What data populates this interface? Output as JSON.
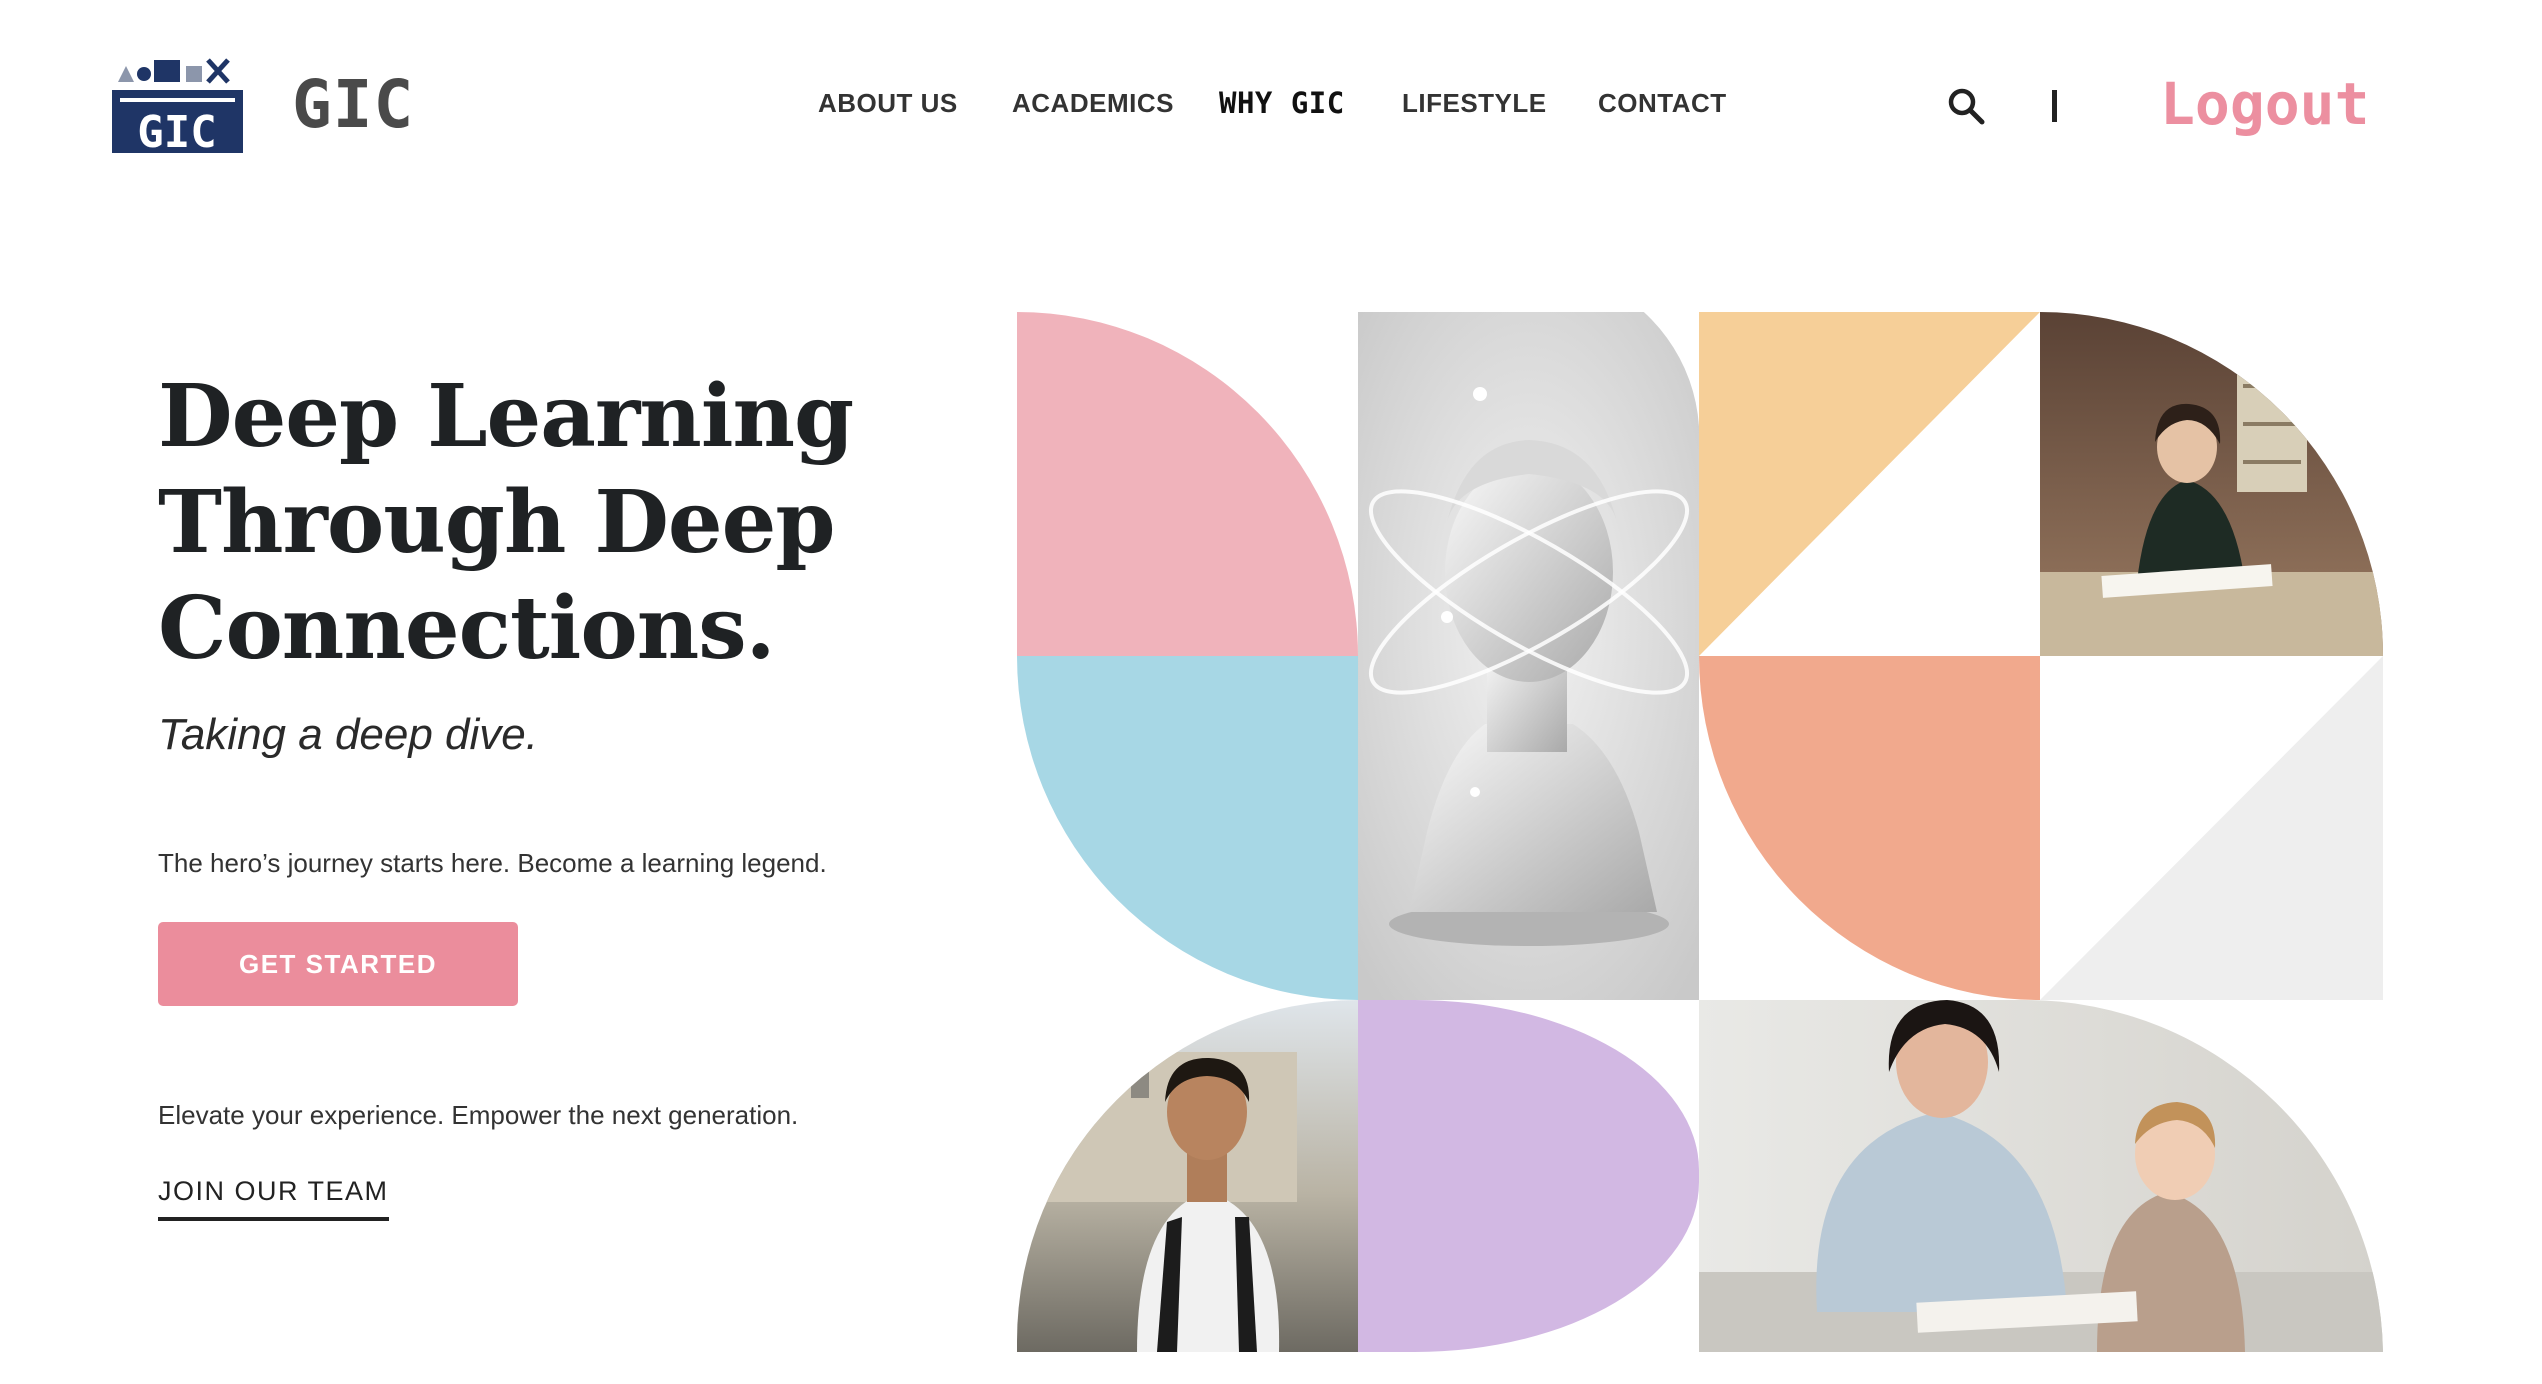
{
  "header": {
    "brand": "GIC",
    "logo_text": "GIC",
    "nav": [
      {
        "label": "ABOUT US"
      },
      {
        "label": "ACADEMICS"
      },
      {
        "label": "WHY GIC"
      },
      {
        "label": "LIFESTYLE"
      },
      {
        "label": "CONTACT"
      }
    ],
    "search_icon": "search-icon",
    "logout_label": "Logout"
  },
  "hero": {
    "title_lines": [
      "Deep Learning",
      "Through Deep",
      "Connections."
    ],
    "subtitle": "Taking a deep dive.",
    "description": "The hero’s journey starts here. Become a learning legend.",
    "cta_label": "GET STARTED",
    "secondary_text": "Elevate your experience. Empower the next generation.",
    "join_label": "JOIN OUR TEAM"
  },
  "colors": {
    "accent_pink": "#eb8d9c",
    "logout_pink": "#ec8fa0",
    "tile_pink": "#f0b3bb",
    "tile_blue": "#a7d7e5",
    "tile_peach": "#f6cf98",
    "tile_salmon": "#f1a98d",
    "tile_lavender": "#d2b8e3",
    "tile_gray": "#eeeeee",
    "logo_navy": "#1f3566"
  }
}
